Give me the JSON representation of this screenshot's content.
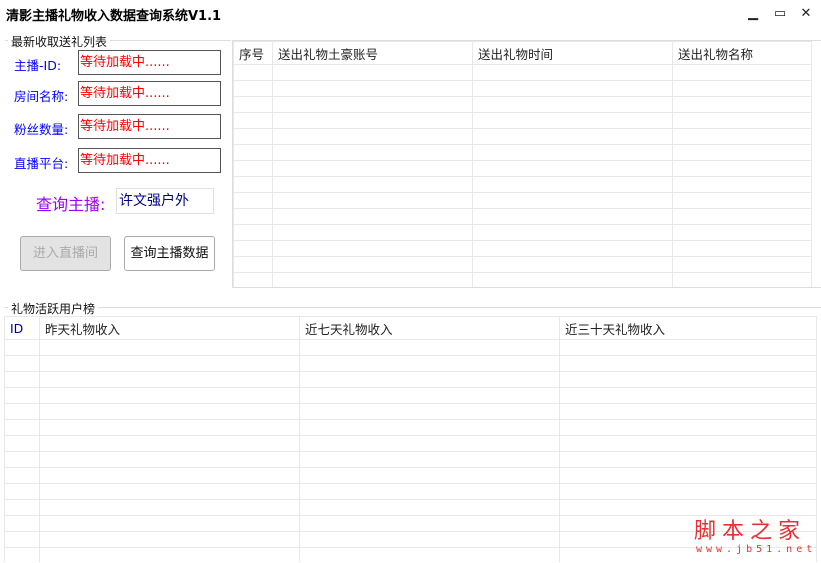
{
  "window": {
    "title": "清影主播礼物收入数据查询系统V1.1",
    "minimize": "▁",
    "maximize": "▭",
    "close": "✕"
  },
  "info_group": {
    "label": "最新收取送礼列表",
    "fields": [
      {
        "label": "主播-ID:",
        "value": "等待加载中......"
      },
      {
        "label": "房间名称:",
        "value": "等待加载中......"
      },
      {
        "label": "粉丝数量:",
        "value": "等待加载中......"
      },
      {
        "label": "直播平台:",
        "value": "等待加载中......"
      }
    ],
    "query_label": "查询主播:",
    "query_value": "许文强户外",
    "enter_button": "进入直播间",
    "query_button": "查询主播数据"
  },
  "gift_table": {
    "columns": [
      "序号",
      "送出礼物土豪账号",
      "送出礼物时间",
      "送出礼物名称"
    ]
  },
  "rank_group": {
    "label": "礼物活跃用户榜",
    "columns": [
      "ID",
      "昨天礼物收入",
      "近七天礼物收入",
      "近三十天礼物收入"
    ]
  },
  "watermark": {
    "logo": "脚本之家",
    "url": "www.jb51.net"
  }
}
